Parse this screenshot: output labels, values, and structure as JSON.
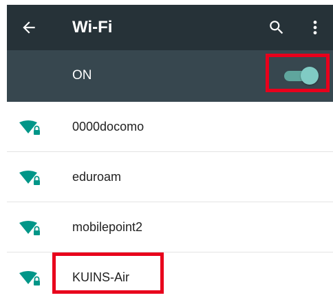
{
  "appbar": {
    "title": "Wi-Fi",
    "back_icon": "arrow-left-icon",
    "search_icon": "search-icon",
    "more_icon": "more-vertical-icon"
  },
  "toggle": {
    "label": "ON",
    "state": "on",
    "accent_color": "#80cbc4"
  },
  "networks": [
    {
      "ssid": "0000docomo",
      "icon": "wifi-lock-icon"
    },
    {
      "ssid": "eduroam",
      "icon": "wifi-lock-icon"
    },
    {
      "ssid": "mobilepoint2",
      "icon": "wifi-lock-icon"
    },
    {
      "ssid": "KUINS-Air",
      "icon": "wifi-lock-icon"
    }
  ],
  "colors": {
    "appbar": "#263238",
    "togglebar": "#37474f",
    "wifi_icon": "#009688",
    "highlight": "#e8001c"
  }
}
